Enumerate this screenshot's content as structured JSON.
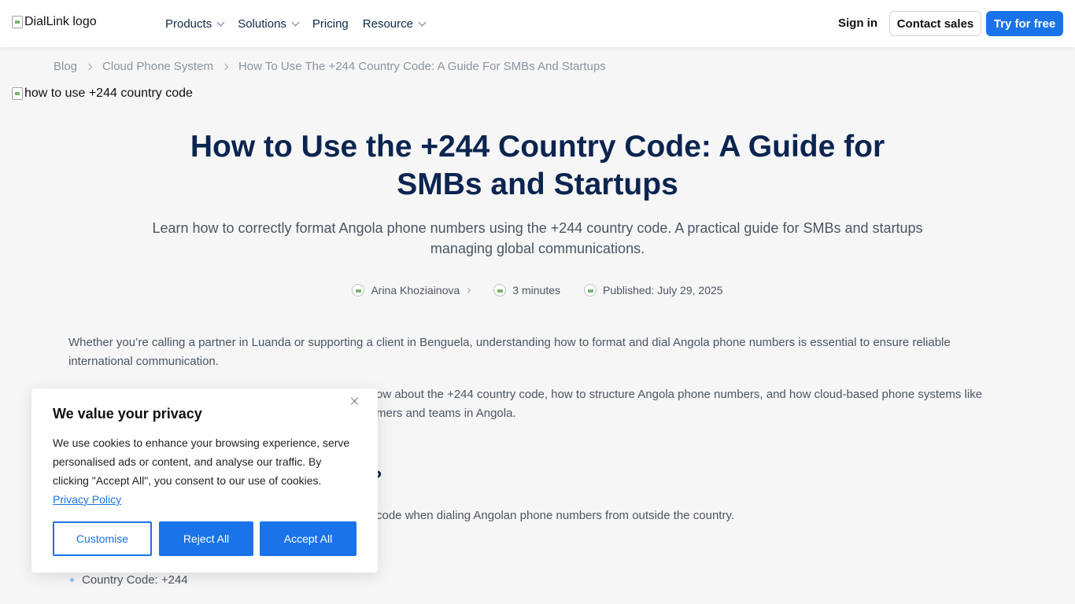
{
  "header": {
    "logo_alt": "DialLink logo",
    "nav": [
      "Products",
      "Solutions",
      "Pricing",
      "Resource"
    ],
    "sign_in": "Sign in",
    "contact_sales": "Contact sales",
    "try_free": "Try for free"
  },
  "breadcrumb": [
    "Blog",
    "Cloud Phone System",
    "How To Use The +244 Country Code: A Guide For SMBs And Startups"
  ],
  "hero_alt": "how to use +244 country code",
  "article": {
    "title": "How to Use the +244 Country Code: A Guide for SMBs and Startups",
    "subtitle": "Learn how to correctly format Angola phone numbers using the +244 country code. A practical guide for SMBs and startups managing global communications.",
    "author": "Arina Khoziainova",
    "read_time": "3 minutes",
    "published": "Published: July 29, 2025",
    "p1": "Whether you’re calling a partner in Luanda or supporting a client in Benguela, understanding how to format and dial Angola phone numbers is essential to ensure reliable international communication.",
    "p2_visible": "ow about the +244 country code, how to structure Angola phone numbers, and how cloud-based phone systems like",
    "p2_visible_2": "mers and teams in Angola.",
    "h2_visible": "?",
    "p3_visible": "code when dialing Angolan phone numbers from outside the country.",
    "bullet1": "Country Code: +244"
  },
  "cookie": {
    "title": "We value your privacy",
    "text": "We use cookies to enhance your browsing experience, serve personalised ads or content, and analyse our traffic. By clicking \"Accept All\", you consent to our use of cookies.",
    "link": "Privacy Policy",
    "customise": "Customise",
    "reject": "Reject All",
    "accept": "Accept All"
  }
}
